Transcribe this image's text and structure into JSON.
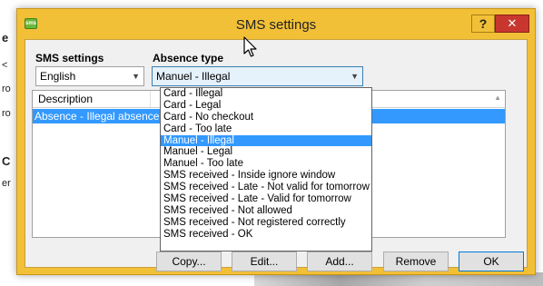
{
  "background": {
    "fragments": [
      "e",
      "<",
      "ro",
      "ro",
      "C",
      "er"
    ]
  },
  "window": {
    "title": "SMS settings",
    "icon_text": "sms",
    "help_label": "?",
    "close_label": "✕"
  },
  "sms_settings": {
    "label": "SMS settings",
    "selected": "English"
  },
  "absence_type": {
    "label": "Absence type",
    "selected": "Manuel - Illegal",
    "options": [
      "Card - Illegal",
      "Card - Legal",
      "Card - No checkout",
      "Card - Too late",
      "Manuel - Illegal",
      "Manuel - Legal",
      "Manuel - Too late",
      "SMS received - Inside ignore window",
      "SMS received - Late - Not valid for tomorrow",
      "SMS received - Late - Valid for tomorrow",
      "SMS received - Not allowed",
      "SMS received - Not registered correctly",
      "SMS received - OK"
    ],
    "highlighted_index": 4
  },
  "list": {
    "column_header": "Description",
    "rows": [
      "Absence - Illegal absence"
    ]
  },
  "buttons": {
    "copy": "Copy...",
    "edit": "Edit...",
    "add": "Add...",
    "remove": "Remove",
    "ok": "OK"
  },
  "colors": {
    "title_bar": "#f2c037",
    "close_button": "#c7372f",
    "selection": "#3399ff"
  }
}
